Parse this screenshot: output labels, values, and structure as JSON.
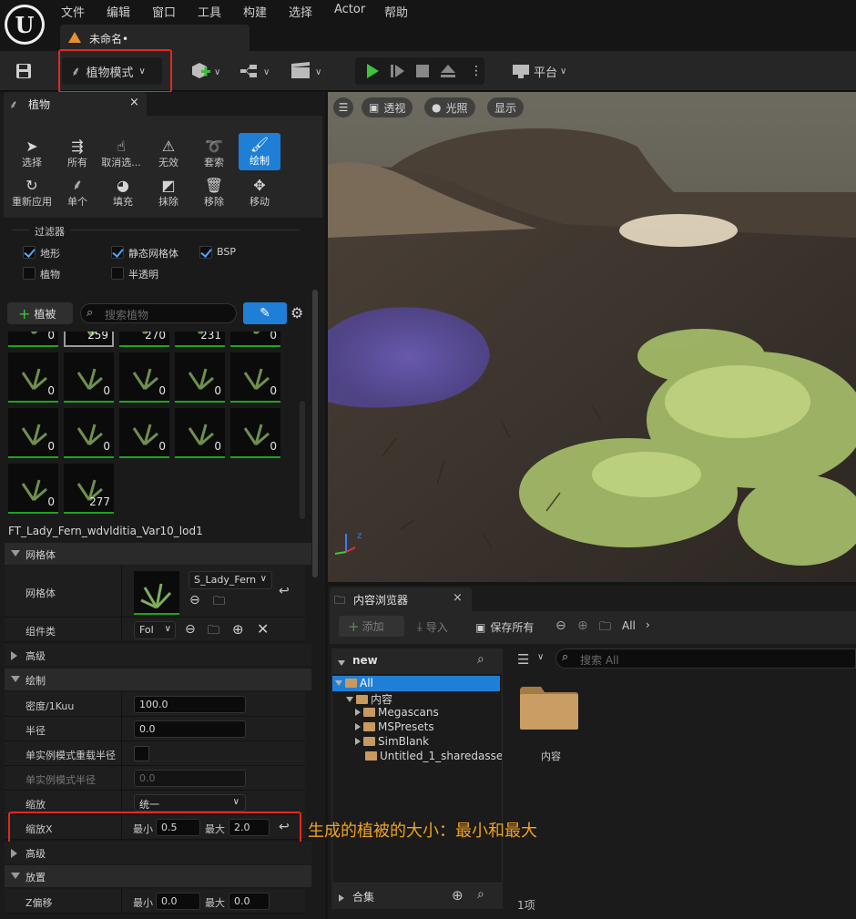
{
  "menubar": {
    "items": [
      "文件",
      "编辑",
      "窗口",
      "工具",
      "构建",
      "选择",
      "Actor",
      "帮助"
    ],
    "document_tab": "未命名•"
  },
  "toolbar": {
    "mode_label": "植物模式",
    "platform_label": "平台"
  },
  "foliage_panel": {
    "tab_title": "植物",
    "tools_row1": [
      "选择",
      "所有",
      "取消选...",
      "无效",
      "套索",
      "绘制"
    ],
    "tools_row2": [
      "重新应用",
      "单个",
      "填充",
      "抹除",
      "移除",
      "移动"
    ],
    "active_tool": "绘制",
    "filters": {
      "title": "过滤器",
      "items": [
        {
          "label": "地形",
          "checked": true
        },
        {
          "label": "静态网格体",
          "checked": true
        },
        {
          "label": "BSP",
          "checked": true
        },
        {
          "label": "植物",
          "checked": false
        },
        {
          "label": "半透明",
          "checked": false
        }
      ]
    },
    "add_button": "植被",
    "search_placeholder": "搜索植物",
    "thumb_counts": [
      "0",
      "259",
      "270",
      "231",
      "0",
      "0",
      "0",
      "0",
      "0",
      "0",
      "0",
      "0",
      "0",
      "0",
      "0",
      "0",
      "277"
    ],
    "selected_asset": "FT_Lady_Fern_wdvlditia_Var10_lod1",
    "sections": {
      "mesh": "网格体",
      "advanced": "高级",
      "paint": "绘制",
      "advanced2": "高级",
      "placement": "放置"
    },
    "props": {
      "mesh_label": "网格体",
      "mesh_value": "S_Lady_Fern",
      "component_label": "组件类",
      "component_value": "Fol",
      "density_label": "密度/1Kuu",
      "density_value": "100.0",
      "radius_label": "半径",
      "radius_value": "0.0",
      "single_reapply_label": "单实例模式重载半径",
      "single_radius_label": "单实例模式半径",
      "single_radius_value": "0.0",
      "scaling_label": "缩放",
      "scaling_value": "统一",
      "scale_x_label": "缩放X",
      "min_label": "最小",
      "scale_min": "0.5",
      "max_label": "最大",
      "scale_max": "2.0",
      "z_offset_label": "Z偏移",
      "z_min": "0.0",
      "z_max": "0.0"
    }
  },
  "viewport": {
    "perspective": "透视",
    "lit": "光照",
    "show": "显示"
  },
  "content_browser": {
    "tab_title": "内容浏览器",
    "add": "添加",
    "import": "导入",
    "save_all": "保存所有",
    "path": "All",
    "tree_header": "new",
    "tree": [
      "All",
      "内容",
      "Megascans",
      "MSPresets",
      "SimBlank",
      "Untitled_1_sharedasse"
    ],
    "search_placeholder": "搜索 All",
    "folder_label": "内容",
    "item_count": "1项",
    "collections": "合集"
  },
  "annotation": "生成的植被的大小：最小和最大",
  "colors": {
    "accent": "#1f7fd6",
    "highlight": "#e02a22",
    "annotation": "#f0a21f",
    "green": "#1fa31f"
  }
}
